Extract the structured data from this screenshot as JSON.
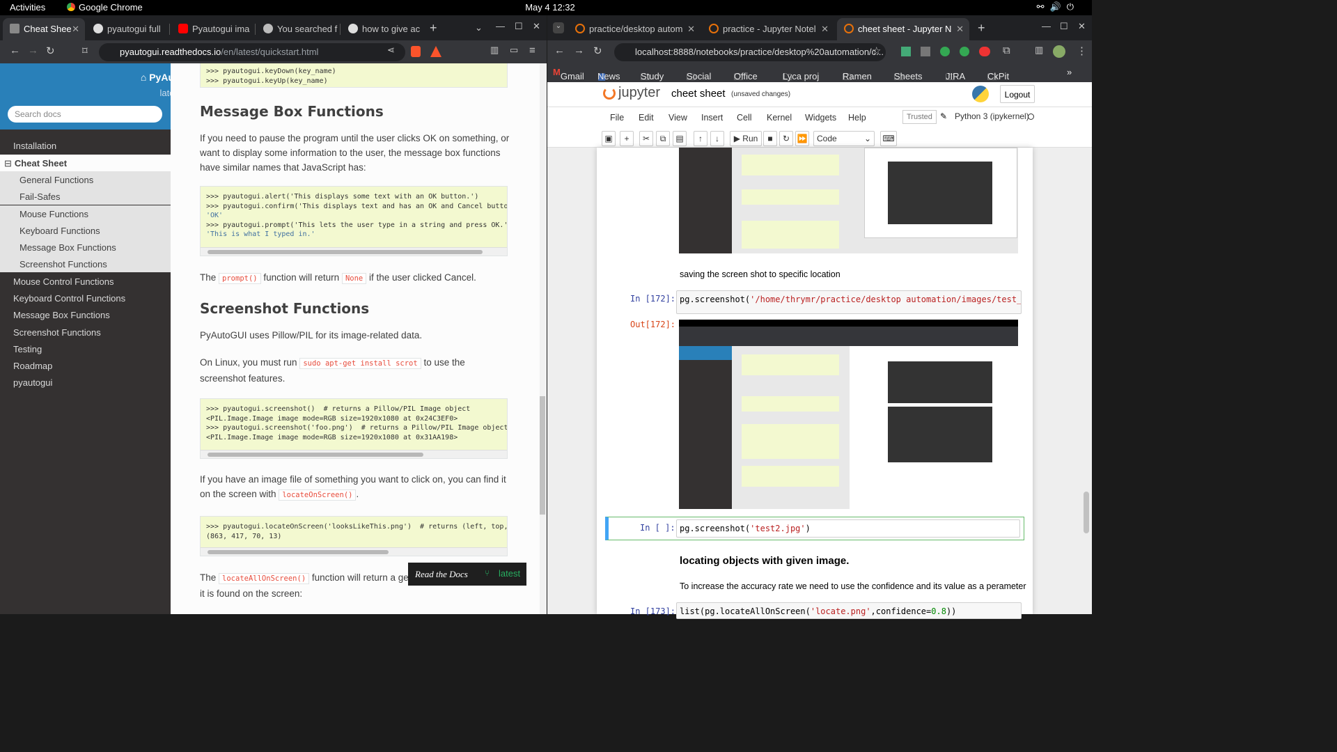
{
  "topbar": {
    "activities": "Activities",
    "app": "Google Chrome",
    "clock": "May 4  12:32"
  },
  "left_browser": {
    "tabs": [
      {
        "label": "Cheat Shee",
        "color": "#5f6368"
      },
      {
        "label": "pyautogui full",
        "color": "#dddddd"
      },
      {
        "label": "Pyautogui ima",
        "color": "#ff0000"
      },
      {
        "label": "You searched f",
        "color": "#bbbbbb"
      },
      {
        "label": "how to give ac",
        "color": "#dddddd"
      }
    ],
    "url_host": "pyautogui.readthedocs.io",
    "url_path": "/en/latest/quickstart.html"
  },
  "rtd": {
    "project": "⌂ PyAutoGUI",
    "version": "latest",
    "search_placeholder": "Search docs",
    "nav": {
      "installation": "Installation",
      "cheat_sheet": "Cheat Sheet",
      "sub": [
        "General Functions",
        "Fail-Safes",
        "Mouse Functions",
        "Keyboard Functions",
        "Message Box Functions",
        "Screenshot Functions"
      ],
      "rest": [
        "Mouse Control Functions",
        "Keyboard Control Functions",
        "Message Box Functions",
        "Screenshot Functions",
        "Testing",
        "Roadmap",
        "pyautogui"
      ]
    },
    "badge_rtd": "Read the Docs",
    "badge_ver": "latest"
  },
  "doc": {
    "code0": [
      ">>> pyautogui.keyDown(key_name)",
      ">>> pyautogui.keyUp(key_name)"
    ],
    "h_msgbox": "Message Box Functions",
    "p_msgbox": "If you need to pause the program until the user clicks OK on something, or want to display some information to the user, the message box functions have similar names that JavaScript has:",
    "code1": [
      ">>> pyautogui.alert('This displays some text with an OK button.')",
      ">>> pyautogui.confirm('This displays text and has an OK and Cancel button",
      "'OK'",
      ">>> pyautogui.prompt('This lets the user type in a string and press OK.')",
      "'This is what I typed in.'"
    ],
    "p_prompt_a": "The",
    "p_prompt_code": "prompt()",
    "p_prompt_b": "function will return",
    "p_prompt_none": "None",
    "p_prompt_c": "if the user clicked Cancel.",
    "h_screenshot": "Screenshot Functions",
    "p_pillow": "PyAutoGUI uses Pillow/PIL for its image-related data.",
    "p_linux_a": "On Linux, you must run",
    "p_linux_code": "sudo apt-get install scrot",
    "p_linux_b": "to use the screenshot features.",
    "code2": [
      ">>> pyautogui.screenshot()  # returns a Pillow/PIL Image object",
      "<PIL.Image.Image image mode=RGB size=1920x1080 at 0x24C3EF0>",
      ">>> pyautogui.screenshot('foo.png')  # returns a Pillow/PIL Image object,",
      "<PIL.Image.Image image mode=RGB size=1920x1080 at 0x31AA198>"
    ],
    "p_locate_a": "If you have an image file of something you want to click on, you can find it on the screen with",
    "p_locate_code": "locateOnScreen()",
    "code3": [
      ">>> pyautogui.locateOnScreen('looksLikeThis.png')  # returns (left, top, w",
      "(863, 417, 70, 13)"
    ],
    "p_all_a": "The",
    "p_all_code": "locateAllOnScreen()",
    "p_all_b": "function will return a gene",
    "p_all_c": "it is found on the screen:"
  },
  "right_browser": {
    "tabs": [
      {
        "label": "practice/desktop autom",
        "color": "#e8710a"
      },
      {
        "label": "practice - Jupyter Notel",
        "color": "#e8710a"
      },
      {
        "label": "cheet sheet - Jupyter N",
        "color": "#e8710a"
      }
    ],
    "url": "localhost:8888/notebooks/practice/desktop%20automation/c...",
    "bookmarks": [
      "Gmail",
      "News",
      "Study",
      "Social",
      "Office",
      "Lyca proj",
      "Ramen",
      "Sheets",
      "JIRA",
      "CkPit"
    ]
  },
  "jupyter": {
    "logo": "jupyter",
    "title": "cheet sheet",
    "status": "(unsaved changes)",
    "logout": "Logout",
    "menu": [
      "File",
      "Edit",
      "View",
      "Insert",
      "Cell",
      "Kernel",
      "Widgets",
      "Help"
    ],
    "trusted": "Trusted",
    "kernel": "Python 3 (ipykernel)",
    "run_label": "Run",
    "cell_type": "Code",
    "md_saving": "saving the screen shot to specific location",
    "in172": "In [172]:",
    "code172a": "pg.screenshot(",
    "code172b": "'/home/thrymr/practice/desktop automation/images/test_with",
    "out172": "Out[172]:",
    "in_empty": "In [ ]:",
    "code_empty_a": "pg.screenshot(",
    "code_empty_b": "'test2.jpg'",
    "code_empty_c": ")",
    "md_heading": "locating objects with given image.",
    "md_conf": "To increase the accuracy rate we need to use the confidence and its value as a perameter",
    "in173": "In [173]:",
    "code173a": "list(pg.locateAllOnScreen(",
    "code173b": "'locate.png'",
    "code173c": ",confidence=",
    "code173d": "0.8",
    "code173e": "))"
  }
}
